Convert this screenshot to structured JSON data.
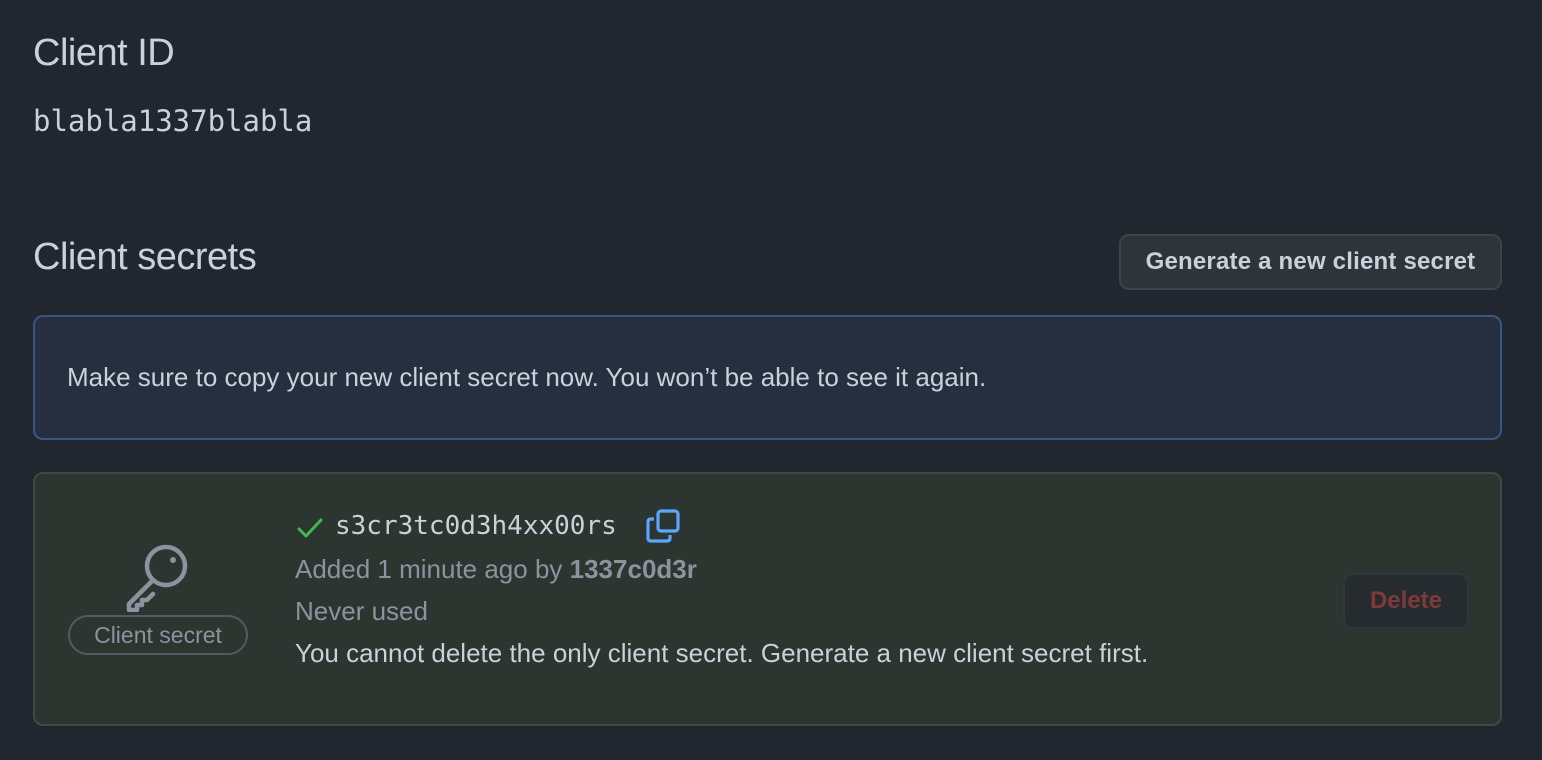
{
  "client_id": {
    "heading": "Client ID",
    "value": "blabla1337blabla"
  },
  "client_secrets": {
    "heading": "Client secrets",
    "generate_button_label": "Generate a new client secret",
    "notice": "Make sure to copy your new client secret now. You won’t be able to see it again.",
    "secret": {
      "label": "Client secret",
      "value": "s3cr3tc0d3h4xx00rs",
      "added_prefix": "Added 1 minute ago by ",
      "added_by": "1337c0d3r",
      "usage": "Never used",
      "delete_warning": "You cannot delete the only client secret. Generate a new client secret first.",
      "delete_button_label": "Delete",
      "delete_disabled": true
    }
  },
  "icons": {
    "key": "key-icon",
    "check": "check-icon",
    "copy": "copy-icon"
  },
  "colors": {
    "background": "#22262e",
    "notice_border": "#3a5582",
    "notice_background": "#252f3f",
    "success_background": "#2c3530",
    "check_green": "#3fb950",
    "copy_blue": "#58a6ff",
    "danger_disabled": "#7d3a3a"
  }
}
